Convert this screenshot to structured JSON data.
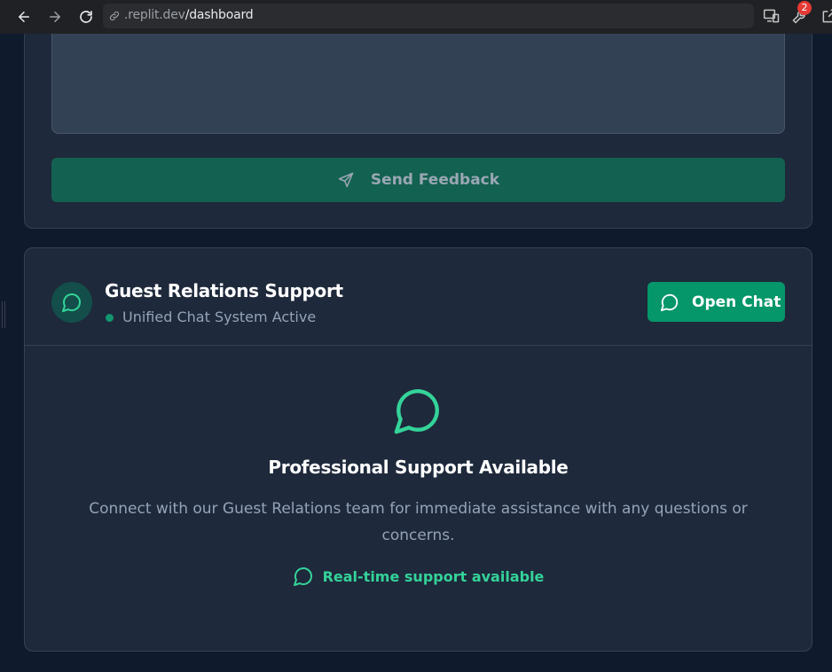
{
  "browser": {
    "url_host": ".replit.dev",
    "url_path": "/dashboard",
    "notification_count": "2"
  },
  "feedback": {
    "send_label": "Send Feedback"
  },
  "support": {
    "title": "Guest Relations Support",
    "status": "Unified Chat System Active",
    "open_chat_label": "Open Chat",
    "body_title": "Professional Support Available",
    "body_description": "Connect with our Guest Relations team for immediate assistance with any questions or concerns.",
    "realtime_label": "Real-time support available"
  },
  "colors": {
    "accent": "#059669",
    "accent_text": "#34d399",
    "card_bg": "#1e293b"
  }
}
